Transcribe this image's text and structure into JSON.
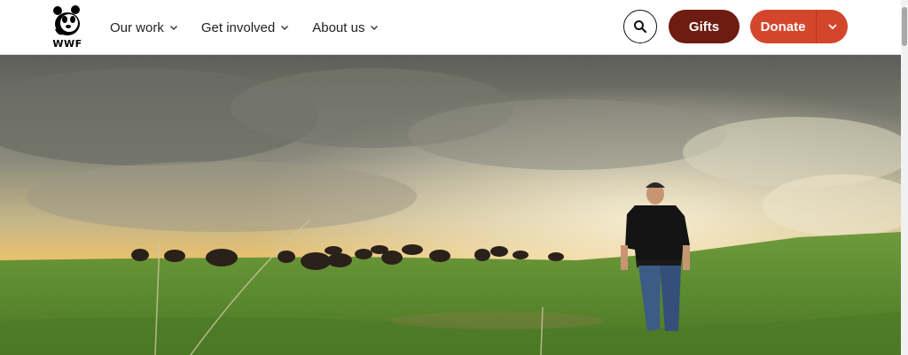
{
  "logo": {
    "text": "WWF"
  },
  "nav": {
    "items": [
      {
        "label": "Our work"
      },
      {
        "label": "Get involved"
      },
      {
        "label": "About us"
      }
    ]
  },
  "header_actions": {
    "search_icon": "search-icon",
    "gifts_label": "Gifts",
    "donate_label": "Donate",
    "donate_dropdown_icon": "chevron-down-icon"
  },
  "colors": {
    "gifts": "#6e1b12",
    "donate": "#d4462c",
    "text": "#222222"
  },
  "hero": {
    "image": "prairie-with-bison-herd-and-man-walking"
  }
}
